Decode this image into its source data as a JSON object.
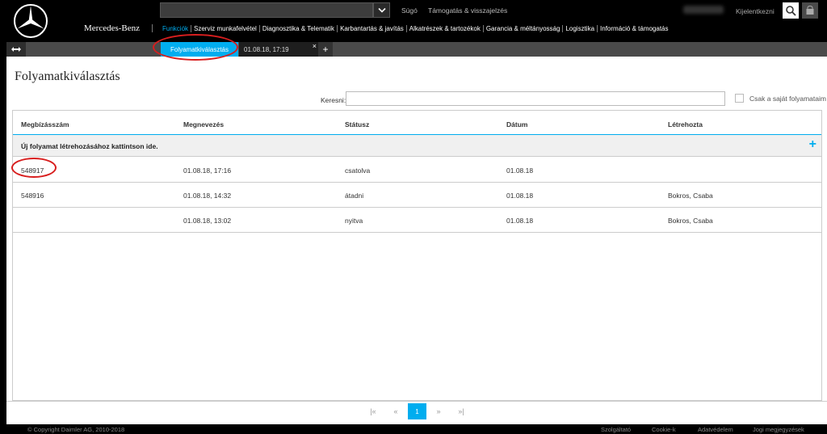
{
  "brand": {
    "name": "Mercedes-Benz"
  },
  "header": {
    "links": {
      "help": "Súgó",
      "support": "Támogatás & visszajelzés",
      "logout": "Kijelentkezni"
    }
  },
  "nav": {
    "items": [
      "Funkciók",
      "Szerviz munkafelvétel",
      "Diagnosztika & Telematik",
      "Karbantartás & javítás",
      "Alkatrészek & tartozékok",
      "Garancia & méltányosság",
      "Logisztika",
      "Információ & támogatás"
    ],
    "active_index": 0
  },
  "tabs": {
    "active_label": "Folyamatkiválasztás",
    "inactive_label": "01.08.18, 17:19",
    "close_glyph": "×",
    "add_glyph": "+"
  },
  "page": {
    "title": "Folyamatkiválasztás",
    "search_label": "Keresni:",
    "search_value": "",
    "own_only_label": "Csak a saját folyamataim"
  },
  "table": {
    "columns": [
      "Megbízásszám",
      "Megnevezés",
      "Státusz",
      "Dátum",
      "Létrehozta"
    ],
    "new_row_label": "Új folyamat létrehozásához kattintson ide.",
    "rows": [
      [
        "548917",
        "01.08.18, 17:16",
        "csatolva",
        "01.08.18",
        ""
      ],
      [
        "548916",
        "01.08.18, 14:32",
        "átadni",
        "01.08.18",
        "Bokros, Csaba"
      ],
      [
        "",
        "01.08.18, 13:02",
        "nyitva",
        "01.08.18",
        "Bokros, Csaba"
      ]
    ]
  },
  "pagination": {
    "first": "|«",
    "prev": "«",
    "current": "1",
    "next": "»",
    "last": "»|"
  },
  "footer": {
    "copyright": "© Copyright Daimler AG, 2010-2018",
    "links": [
      "Szolgáltató",
      "Cookie-k",
      "Adatvédelem",
      "Jogi megjegyzések"
    ]
  },
  "colors": {
    "accent": "#00adef",
    "header_bg": "#000000",
    "tabbar_bg": "#4a4a4a",
    "annotation": "#d81e1e"
  }
}
